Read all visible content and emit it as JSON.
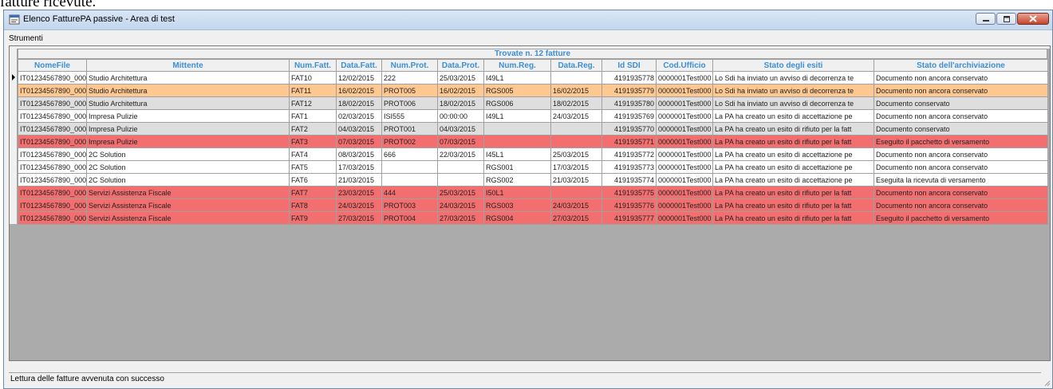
{
  "page_caption": "fatture ricevute.",
  "window": {
    "title": "Elenco FatturePA passive - Area di test"
  },
  "menu": {
    "items": [
      "Strumenti"
    ]
  },
  "grid": {
    "group_header": "Trovate n. 12 fatture",
    "columns": [
      "NomeFile",
      "Mittente",
      "Num.Fatt.",
      "Data.Fatt.",
      "Num.Prot.",
      "Data.Prot.",
      "Num.Reg.",
      "Data.Reg.",
      "Id SDI",
      "Cod.Ufficio",
      "Stato degli esiti",
      "Stato dell'archiviazione"
    ],
    "rows": [
      {
        "style": "white",
        "selected": true,
        "cells": [
          "IT01234567890_000",
          "Studio Architettura",
          "FAT10",
          "12/02/2015",
          "222",
          "25/03/2015",
          "I49L1",
          "",
          "4191935778",
          "0000001Test000",
          "Lo Sdi ha inviato un avviso di decorrenza te",
          "Documento non ancora conservato"
        ]
      },
      {
        "style": "orange",
        "selected": false,
        "cells": [
          "IT01234567890_000",
          "Studio Architettura",
          "FAT11",
          "16/02/2015",
          "PROT005",
          "16/02/2015",
          "RGS005",
          "16/02/2015",
          "4191935779",
          "0000001Test000",
          "Lo Sdi ha inviato un avviso di decorrenza te",
          "Documento non ancora conservato"
        ]
      },
      {
        "style": "gray",
        "selected": false,
        "cells": [
          "IT01234567890_000",
          "Studio Architettura",
          "FAT12",
          "18/02/2015",
          "PROT006",
          "18/02/2015",
          "RGS006",
          "18/02/2015",
          "4191935780",
          "0000001Test000",
          "Lo Sdi ha inviato un avviso di decorrenza te",
          "Documento conservato"
        ]
      },
      {
        "style": "white",
        "selected": false,
        "cells": [
          "IT01234567890_000",
          "Impresa Pulizie",
          "FAT1",
          "02/03/2015",
          "ISI555",
          "00:00:00",
          "I49L1",
          "24/03/2015",
          "4191935769",
          "0000001Test000",
          "La PA ha creato un esito di accettazione pe",
          "Documento non ancora conservato"
        ]
      },
      {
        "style": "gray",
        "selected": false,
        "cells": [
          "IT01234567890_000",
          "Impresa Pulizie",
          "FAT2",
          "04/03/2015",
          "PROT001",
          "04/03/2015",
          "",
          "",
          "4191935770",
          "0000001Test000",
          "La PA ha creato un esito di rifiuto per la fatt",
          "Documento conservato"
        ]
      },
      {
        "style": "red",
        "selected": false,
        "cells": [
          "IT01234567890_000",
          "Impresa Pulizie",
          "FAT3",
          "07/03/2015",
          "PROT002",
          "07/03/2015",
          "",
          "",
          "4191935771",
          "0000001Test000",
          "La PA ha creato un esito di rifiuto per la fatt",
          "Eseguito il pacchetto di versamento"
        ]
      },
      {
        "style": "white",
        "selected": false,
        "cells": [
          "IT01234567890_000",
          "2C Solution",
          "FAT4",
          "08/03/2015",
          "666",
          "22/03/2015",
          "I45L1",
          "25/03/2015",
          "4191935772",
          "0000001Test000",
          "La PA ha creato un esito di accettazione pe",
          "Documento non ancora conservato"
        ]
      },
      {
        "style": "white",
        "selected": false,
        "cells": [
          "IT01234567890_000",
          "2C Solution",
          "FAT5",
          "17/03/2015",
          "",
          "",
          "RGS001",
          "17/03/2015",
          "4191935773",
          "0000001Test000",
          "La PA ha creato un esito di accettazione pe",
          "Documento non ancora conservato"
        ]
      },
      {
        "style": "white",
        "selected": false,
        "cells": [
          "IT01234567890_000",
          "2C Solution",
          "FAT6",
          "21/03/2015",
          "",
          "",
          "RGS002",
          "21/03/2015",
          "4191935774",
          "0000001Test000",
          "La PA ha creato un esito di accettazione pe",
          "Eseguita la ricevuta di versamento"
        ]
      },
      {
        "style": "red",
        "selected": false,
        "cells": [
          "IT01234567890_000",
          "Servizi Assistenza Fiscale",
          "FAT7",
          "23/03/2015",
          "444",
          "25/03/2015",
          "I50L1",
          "",
          "4191935775",
          "0000001Test000",
          "La PA ha creato un esito di rifiuto per la fatt",
          "Documento non ancora conservato"
        ]
      },
      {
        "style": "red",
        "selected": false,
        "cells": [
          "IT01234567890_000",
          "Servizi Assistenza Fiscale",
          "FAT8",
          "24/03/2015",
          "PROT003",
          "24/03/2015",
          "RGS003",
          "24/03/2015",
          "4191935776",
          "0000001Test000",
          "La PA ha creato un esito di rifiuto per la fatt",
          "Documento non ancora conservato"
        ]
      },
      {
        "style": "red",
        "selected": false,
        "cells": [
          "IT01234567890_000",
          "Servizi Assistenza Fiscale",
          "FAT9",
          "27/03/2015",
          "PROT004",
          "27/03/2015",
          "RGS004",
          "27/03/2015",
          "4191935777",
          "0000001Test000",
          "La PA ha creato un esito di rifiuto per la fatt",
          "Eseguito il pacchetto di versamento"
        ]
      }
    ]
  },
  "status_bar": {
    "text": "Lettura delle fatture avvenuta con successo"
  },
  "colors": {
    "header_text": "#3c8fd6",
    "row_orange": "#ffc890",
    "row_gray": "#dedede",
    "row_red": "#f36f6f",
    "row_white": "#ffffff"
  },
  "icons": {
    "app": "app-window-icon",
    "minimize": "minimize-icon",
    "maximize": "maximize-icon",
    "close": "close-icon",
    "row_pointer": "row-pointer-icon",
    "resize_grip": "resize-grip-icon"
  }
}
